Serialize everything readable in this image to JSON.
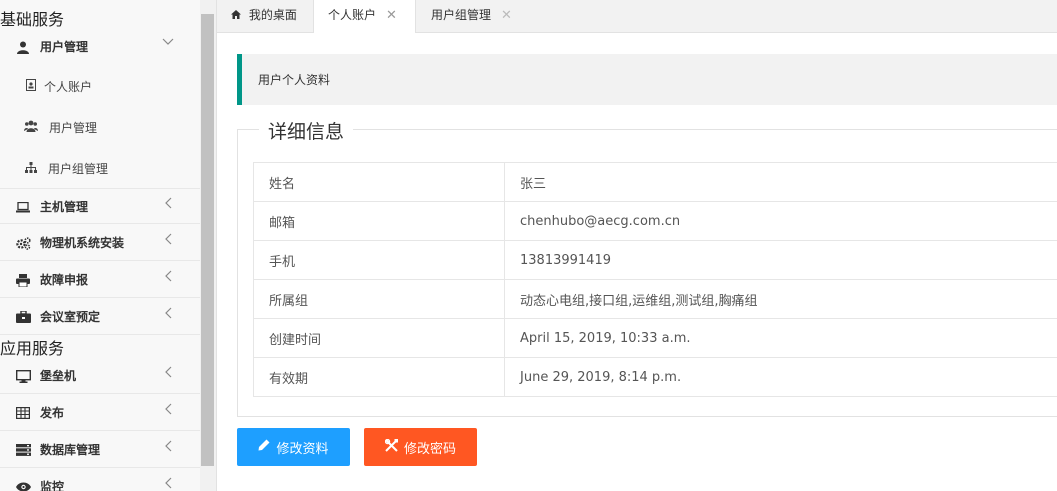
{
  "sidebar": {
    "section1": "基础服务",
    "user_mgmt": "用户管理",
    "sub_items": [
      {
        "label": "个人账户"
      },
      {
        "label": "用户管理"
      },
      {
        "label": "用户组管理"
      }
    ],
    "items_a": [
      {
        "label": "主机管理"
      },
      {
        "label": "物理机系统安装"
      },
      {
        "label": "故障申报"
      },
      {
        "label": "会议室预定"
      }
    ],
    "section2": "应用服务",
    "items_b": [
      {
        "label": "堡垒机"
      },
      {
        "label": "发布"
      },
      {
        "label": "数据库管理"
      },
      {
        "label": "监控"
      }
    ]
  },
  "tabs": [
    {
      "label": "我的桌面"
    },
    {
      "label": "个人账户"
    },
    {
      "label": "用户组管理"
    }
  ],
  "quote": "用户个人资料",
  "legend": "详细信息",
  "rows": [
    {
      "key": "姓名",
      "value": "张三"
    },
    {
      "key": "邮箱",
      "value": "chenhubo@aecg.com.cn"
    },
    {
      "key": "手机",
      "value": "13813991419"
    },
    {
      "key": "所属组",
      "value": "动态心电组,接口组,运维组,测试组,胸痛组"
    },
    {
      "key": "创建时间",
      "value": "April 15, 2019, 10:33 a.m."
    },
    {
      "key": "有效期",
      "value": "June 29, 2019, 8:14 p.m."
    }
  ],
  "buttons": {
    "edit": "修改资料",
    "password": "修改密码"
  },
  "colors": {
    "accent": "#009688",
    "edit_btn": "#1e9fff",
    "pwd_btn": "#ff5722"
  }
}
